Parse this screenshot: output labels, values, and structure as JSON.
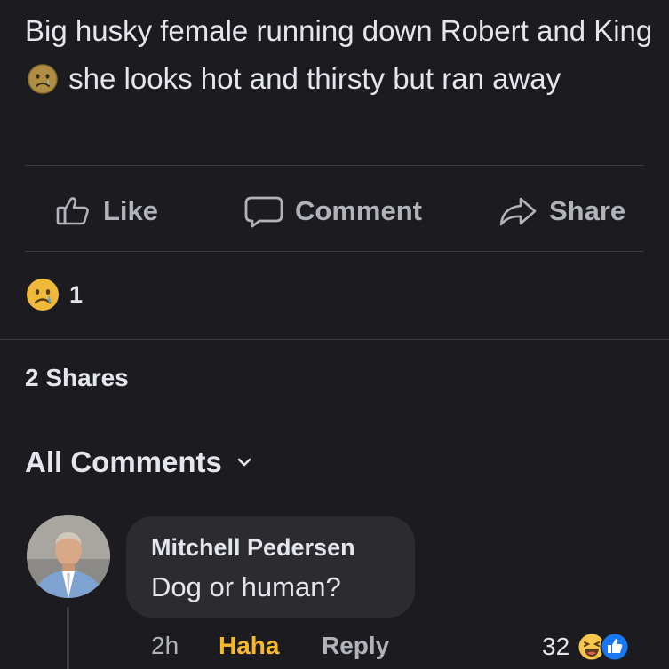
{
  "post": {
    "text_part1": "Big husky female running down Robert and King",
    "text_part2": "she looks hot and thirsty but ran away",
    "inline_emoji": "sad-face-icon"
  },
  "actions": {
    "like_label": "Like",
    "comment_label": "Comment",
    "share_label": "Share"
  },
  "reactions": {
    "count": "1",
    "icon": "sad-reaction-icon"
  },
  "shares": {
    "label": "2 Shares"
  },
  "comments": {
    "header": "All Comments",
    "items": [
      {
        "author": "Mitchell Pedersen",
        "text": "Dog or human?",
        "time": "2h",
        "reaction_label": "Haha",
        "reply_label": "Reply",
        "reaction_count": "32",
        "reaction_icons": [
          "haha-icon",
          "like-icon"
        ]
      }
    ]
  },
  "colors": {
    "background": "#1c1b20",
    "text_primary": "#e4e6eb",
    "text_secondary": "#b0b3b8",
    "bubble": "#2c2c30",
    "haha_accent": "#f7b928",
    "like_blue": "#1877f2"
  }
}
